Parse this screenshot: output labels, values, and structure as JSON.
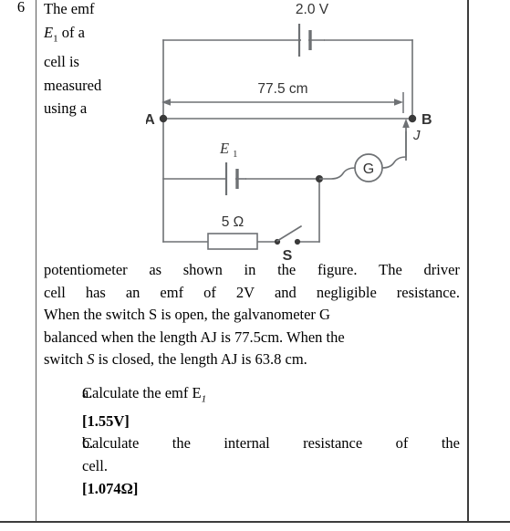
{
  "question": {
    "number": "6",
    "intro_lines": [
      [
        "The",
        "emf"
      ],
      [
        "E1",
        "of",
        "a"
      ],
      [
        "cell",
        "is"
      ],
      [
        "measured"
      ],
      [
        "using",
        "a"
      ]
    ],
    "intro_emf_symbol": "E",
    "intro_emf_subscript": "1",
    "body_lines": [
      [
        "potentiometer",
        "as",
        "shown",
        "in",
        "the",
        "figure.",
        "The",
        "driver"
      ],
      [
        "cell",
        "has",
        "an",
        "emf",
        "of",
        "2V",
        "and",
        "negligible",
        "resistance."
      ],
      [
        "When",
        "the",
        "switch",
        "S",
        "is",
        "open,",
        "the",
        "galvanometer",
        "G",
        "is"
      ],
      [
        "balanced",
        "when",
        "the",
        "length",
        "AJ",
        "is",
        "77.5cm.",
        "When",
        "the"
      ],
      [
        "switch",
        "S",
        "is",
        "closed,",
        "the",
        "length",
        "AJ",
        "is",
        "63.8",
        "cm."
      ]
    ],
    "body_line5_italic_word": "S",
    "answers": [
      {
        "marker": "a.",
        "text": "Calculate the emf E",
        "symbol_sub": "1",
        "result": "[1.55V]"
      },
      {
        "marker": "b.",
        "text_line1": [
          "Calculate",
          "the",
          "internal",
          "resistance",
          "of",
          "the"
        ],
        "text_line2": "cell.",
        "result": "[1.074Ω]"
      }
    ]
  },
  "figure": {
    "driver_cell_label": "2.0 V",
    "wire_length_label": "77.5 cm",
    "terminal_a_label": "A",
    "terminal_b_label": "B",
    "jockey_label": "J",
    "galvanometer_label": "G",
    "cell_label": "E",
    "cell_label_sub": "1",
    "resistor_label": "5 Ω",
    "switch_label": "S",
    "wire_color": "#6e7174",
    "dark_color": "#3a3a3a",
    "label_color": "#333333"
  }
}
